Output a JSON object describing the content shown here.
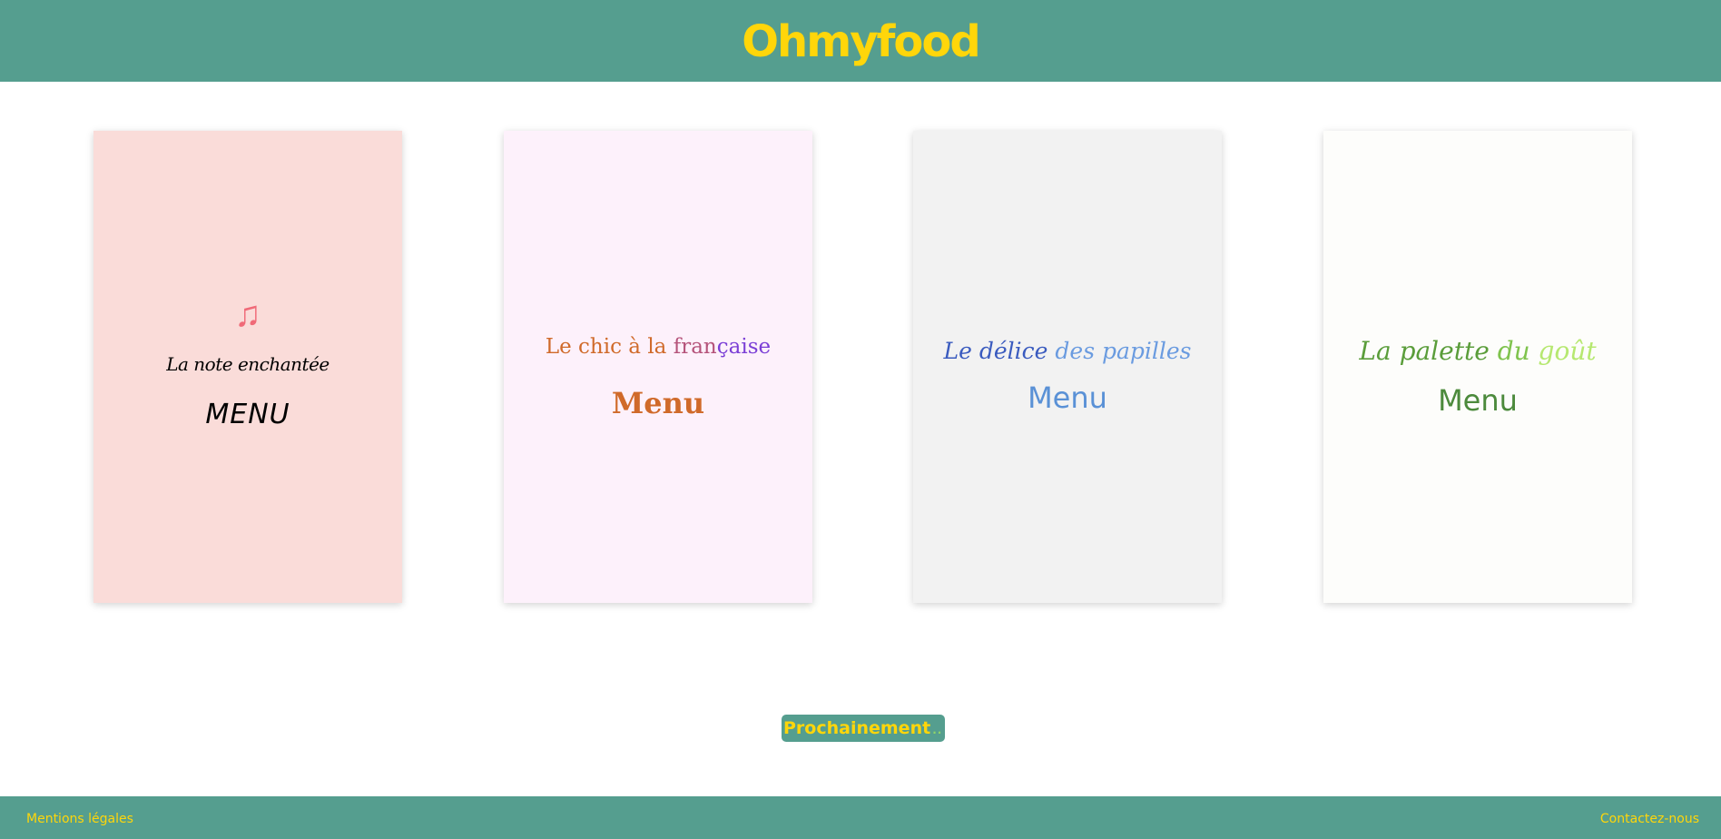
{
  "colors": {
    "header_bg": "#559e8f",
    "logo": "#ffd60a",
    "footer_link": "#ffd60a",
    "card_1_bg": "#fadcd9",
    "card_2_bg": "#fdf1fb",
    "card_3_bg": "#f2f2f2",
    "card_4_bg": "#fdfdfb"
  },
  "header": {
    "logo": "Ohmyfood"
  },
  "restaurants": [
    {
      "icon": "music-notes-icon",
      "name": "La note enchantée",
      "menu_label": "MENU"
    },
    {
      "name_parts": [
        "Le chic à la ",
        "fran",
        "çaise"
      ],
      "menu_label": "Menu"
    },
    {
      "name_parts": [
        "Le délice ",
        "des papilles"
      ],
      "menu_label": "Menu"
    },
    {
      "name_parts": [
        "La palette ",
        "du ",
        "goût"
      ],
      "menu_label": "Menu"
    }
  ],
  "coming_soon": {
    "label": "Prochainement",
    "dots": ".."
  },
  "footer": {
    "legal": "Mentions légales",
    "contact": "Contactez-nous"
  }
}
